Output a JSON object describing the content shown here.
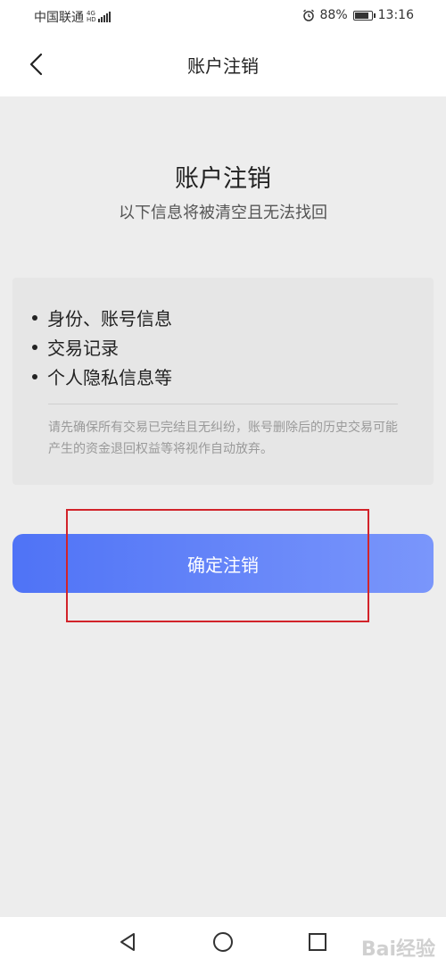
{
  "status_bar": {
    "carrier": "中国联通",
    "network_top": "4G",
    "network_bottom": "HD",
    "battery": "88%",
    "time": "13:16",
    "battery_level": 0.88
  },
  "header": {
    "title": "账户注销"
  },
  "hero": {
    "title": "账户注销",
    "subtitle": "以下信息将被清空且无法找回"
  },
  "info_card": {
    "items": [
      "身份、账号信息",
      "交易记录",
      "个人隐私信息等"
    ],
    "note": "请先确保所有交易已完结且无纠纷，账号删除后的历史交易可能产生的资金退回权益等将视作自动放弃。"
  },
  "confirm_button": {
    "label": "确定注销"
  },
  "colors": {
    "accent_start": "#4f73f6",
    "accent_end": "#7a96fb",
    "highlight": "#d2232a"
  },
  "watermark": {
    "text": "Bai经验"
  }
}
